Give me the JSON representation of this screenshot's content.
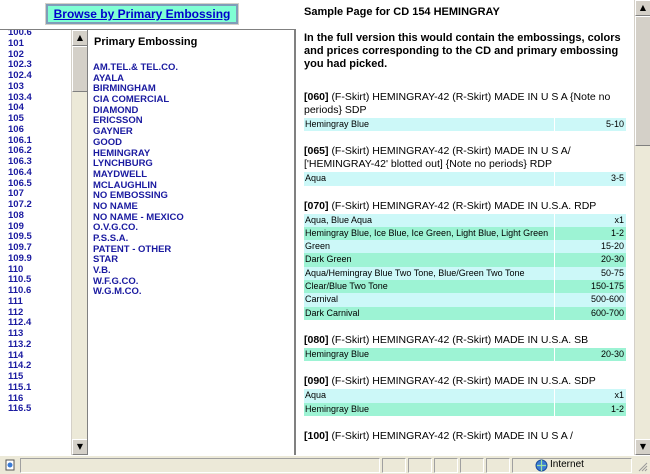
{
  "browse_button": "Browse by Primary Embossing",
  "cd_numbers": [
    "100.6",
    "101",
    "102",
    "102.3",
    "102.4",
    "103",
    "103.4",
    "104",
    "105",
    "106",
    "106.1",
    "106.2",
    "106.3",
    "106.4",
    "106.5",
    "107",
    "107.2",
    "108",
    "109",
    "109.5",
    "109.7",
    "109.9",
    "110",
    "110.5",
    "110.6",
    "111",
    "112",
    "112.4",
    "113",
    "113.2",
    "114",
    "114.2",
    "115",
    "115.1",
    "116",
    "116.5"
  ],
  "embossing": {
    "title": "Primary Embossing",
    "items": [
      "AM.TEL.& TEL.CO.",
      "AYALA",
      "BIRMINGHAM",
      "CIA COMERCIAL",
      "DIAMOND",
      "ERICSSON",
      "GAYNER",
      "GOOD",
      "HEMINGRAY",
      "LYNCHBURG",
      "MAYDWELL",
      "MCLAUGHLIN",
      "NO EMBOSSING",
      "NO NAME",
      "NO NAME - MEXICO",
      "O.V.G.CO.",
      "P.S.S.A.",
      "PATENT - OTHER",
      "STAR",
      "V.B.",
      "W.F.G.CO.",
      "W.G.M.CO."
    ]
  },
  "page": {
    "title": "Sample Page for CD 154 HEMINGRAY",
    "intro": "In the full version this would contain the embossings, colors and prices corresponding to the CD and primary embossing you had picked.",
    "blocks": [
      {
        "code": "[060]",
        "desc": "(F-Skirt) HEMINGRAY-42 (R-Skirt) MADE IN U S A {Note no periods} SDP",
        "rows": [
          {
            "color": "Hemingray Blue",
            "price": "5-10",
            "shade": "lt"
          }
        ]
      },
      {
        "code": "[065]",
        "desc": "(F-Skirt) HEMINGRAY-42 (R-Skirt) MADE IN U S A/ ['HEMINGRAY-42' blotted out] {Note no periods} RDP",
        "rows": [
          {
            "color": "Aqua",
            "price": "3-5",
            "shade": "lt"
          }
        ]
      },
      {
        "code": "[070]",
        "desc": "(F-Skirt) HEMINGRAY-42 (R-Skirt) MADE IN U.S.A. RDP",
        "rows": [
          {
            "color": "Aqua, Blue Aqua",
            "price": "x1",
            "shade": "lt"
          },
          {
            "color": "Hemingray Blue, Ice Blue, Ice Green, Light Blue, Light Green",
            "price": "1-2",
            "shade": "md"
          },
          {
            "color": "Green",
            "price": "15-20",
            "shade": "lt"
          },
          {
            "color": "Dark Green",
            "price": "20-30",
            "shade": "md"
          },
          {
            "color": "Aqua/Hemingray Blue Two Tone, Blue/Green Two Tone",
            "price": "50-75",
            "shade": "lt"
          },
          {
            "color": "Clear/Blue Two Tone",
            "price": "150-175",
            "shade": "md"
          },
          {
            "color": "Carnival",
            "price": "500-600",
            "shade": "lt"
          },
          {
            "color": "Dark Carnival",
            "price": "600-700",
            "shade": "md"
          }
        ]
      },
      {
        "code": "[080]",
        "desc": "(F-Skirt) HEMINGRAY-42 (R-Skirt) MADE IN U.S.A. SB",
        "rows": [
          {
            "color": "Hemingray Blue",
            "price": "20-30",
            "shade": "md"
          }
        ]
      },
      {
        "code": "[090]",
        "desc": "(F-Skirt) HEMINGRAY-42 (R-Skirt) MADE IN U.S.A. SDP",
        "rows": [
          {
            "color": "Aqua",
            "price": "x1",
            "shade": "lt"
          },
          {
            "color": "Hemingray Blue",
            "price": "1-2",
            "shade": "md"
          }
        ]
      },
      {
        "code": "[100]",
        "desc": "(F-Skirt) HEMINGRAY-42 (R-Skirt) MADE IN U S A /",
        "rows": []
      }
    ]
  },
  "status": {
    "zone": "Internet"
  },
  "colors": {
    "button_bg": "#7fffd4",
    "link": "#1a1aa0",
    "row_light": "#ccf8f8",
    "row_medium": "#9df3d4"
  }
}
